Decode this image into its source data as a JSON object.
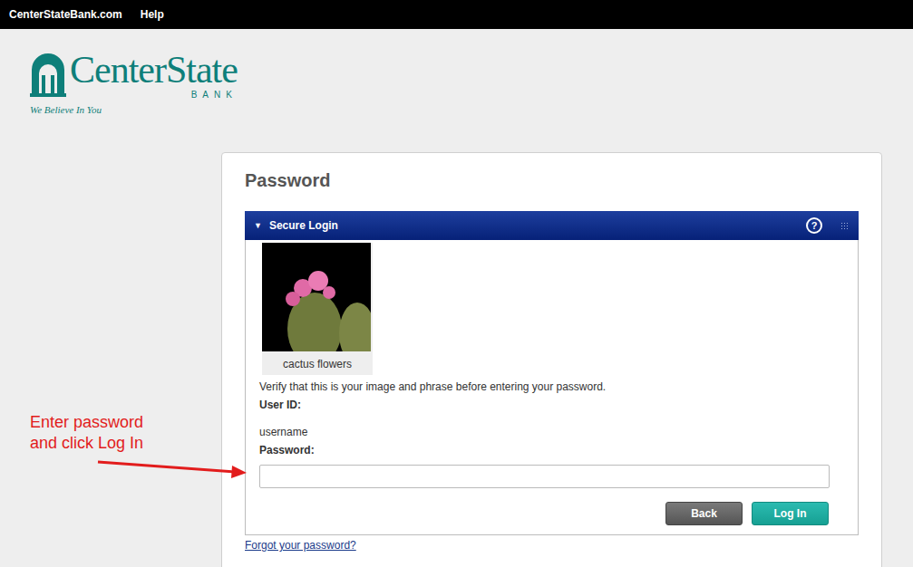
{
  "top_bar": {
    "links": [
      "CenterStateBank.com",
      "Help"
    ]
  },
  "logo": {
    "name": "CenterState",
    "sub": "BANK",
    "tagline": "We Believe In You"
  },
  "page_title": "Password",
  "panel": {
    "title": "Secure Login",
    "toggle": "▼",
    "help": "?",
    "expanded": true
  },
  "security_image": {
    "caption": "cactus flowers"
  },
  "verify_text": "Verify that this is your image and phrase before entering your password.",
  "user_id": {
    "label": "User ID:",
    "value": "username"
  },
  "password": {
    "label": "Password:"
  },
  "buttons": [
    {
      "label": "Back",
      "kind": "secondary"
    },
    {
      "label": "Log In",
      "kind": "primary"
    }
  ],
  "forgot_link": "Forgot your password?",
  "annotation": {
    "lines": [
      "Enter password",
      "and click Log In"
    ]
  }
}
